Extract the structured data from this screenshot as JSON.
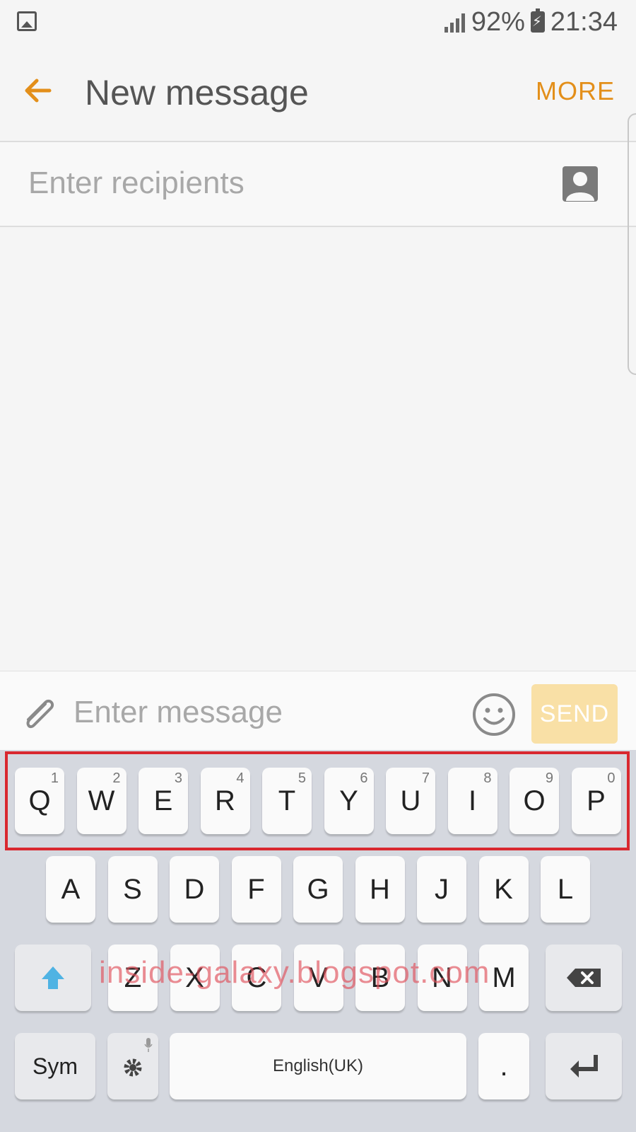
{
  "status_bar": {
    "battery_percent": "92%",
    "time": "21:34"
  },
  "header": {
    "title": "New message",
    "more_label": "MORE"
  },
  "recipients": {
    "placeholder": "Enter recipients"
  },
  "composer": {
    "placeholder": "Enter message",
    "send_label": "SEND"
  },
  "keyboard": {
    "row1": [
      {
        "label": "Q",
        "hint": "1"
      },
      {
        "label": "W",
        "hint": "2"
      },
      {
        "label": "E",
        "hint": "3"
      },
      {
        "label": "R",
        "hint": "4"
      },
      {
        "label": "T",
        "hint": "5"
      },
      {
        "label": "Y",
        "hint": "6"
      },
      {
        "label": "U",
        "hint": "7"
      },
      {
        "label": "I",
        "hint": "8"
      },
      {
        "label": "O",
        "hint": "9"
      },
      {
        "label": "P",
        "hint": "0"
      }
    ],
    "row2": [
      "A",
      "S",
      "D",
      "F",
      "G",
      "H",
      "J",
      "K",
      "L"
    ],
    "row3": [
      "Z",
      "X",
      "C",
      "V",
      "B",
      "N",
      "M"
    ],
    "sym_label": "Sym",
    "space_label": "English(UK)",
    "period_label": "."
  },
  "watermark": "inside-galaxy.blogspot.com",
  "colors": {
    "accent": "#e38f1a",
    "send_disabled": "#f9e0a6",
    "highlight": "#d9282f",
    "shift": "#4fb3e3"
  }
}
